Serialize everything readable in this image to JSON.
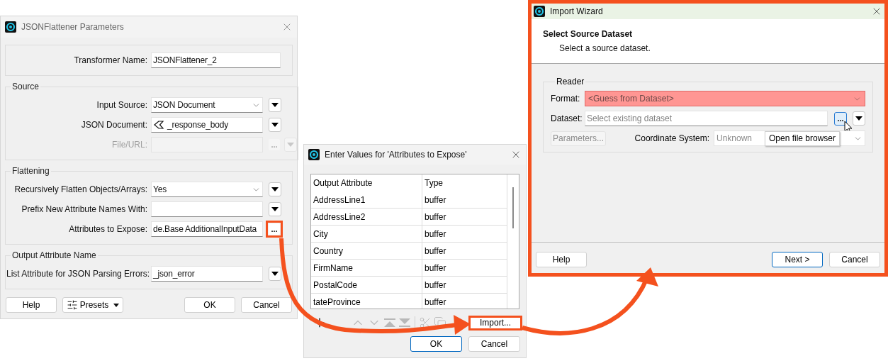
{
  "parameters_dialog": {
    "title": "JSONFlattener Parameters",
    "groups": [
      {
        "rows": [
          {
            "label": "Transformer Name:",
            "kind": "text",
            "value": "JSONFlattener_2",
            "disabled": false,
            "menu": false
          }
        ]
      },
      {
        "title": "Source",
        "rows": [
          {
            "label": "Input Source:",
            "kind": "select",
            "value": "JSON Document",
            "disabled": false,
            "menu": true
          },
          {
            "label": "JSON Document:",
            "kind": "attribute",
            "value": "_response_body",
            "disabled": false,
            "menu": true
          },
          {
            "label": "File/URL:",
            "kind": "text",
            "disabled": true,
            "browse": "...",
            "menu": true
          }
        ]
      },
      {
        "title": "Flattening",
        "rows": [
          {
            "label": "Recursively Flatten Objects/Arrays:",
            "kind": "select",
            "value": "Yes",
            "disabled": false,
            "menu": true
          },
          {
            "label": "Prefix New Attribute Names With:",
            "kind": "text",
            "disabled": false,
            "menu": true
          },
          {
            "label": "Attributes to Expose:",
            "kind": "text",
            "value": "de.Base AdditionalInputData",
            "disabled": false,
            "browse": "...",
            "callout": true,
            "menu": false
          }
        ]
      },
      {
        "title": "Output Attribute Name",
        "rows": [
          {
            "label": "List Attribute for JSON Parsing Errors:",
            "kind": "text",
            "value": "_json_error",
            "disabled": false,
            "menu": true
          }
        ]
      }
    ],
    "buttons": [
      {
        "kind": "help",
        "label": "Help"
      },
      {
        "kind": "presets",
        "label": "Presets"
      },
      {
        "kind": "ok",
        "label": "OK"
      },
      {
        "kind": "cancel",
        "label": "Cancel"
      }
    ]
  },
  "values_dialog": {
    "title": "Enter Values for 'Attributes to Expose'",
    "columns": [
      "Output Attribute",
      "Type"
    ],
    "rows": [
      [
        "AddressLine1",
        "buffer"
      ],
      [
        "AddressLine2",
        "buffer"
      ],
      [
        "City",
        "buffer"
      ],
      [
        "Country",
        "buffer"
      ],
      [
        "FirmName",
        "buffer"
      ],
      [
        "PostalCode",
        "buffer"
      ],
      [
        "tateProvince",
        "buffer"
      ]
    ],
    "toolbar": [
      {
        "kind": "add",
        "disabled": false
      },
      {
        "kind": "up",
        "disabled": true
      },
      {
        "kind": "down",
        "disabled": true
      },
      {
        "kind": "top",
        "disabled": true
      },
      {
        "kind": "bottom",
        "disabled": true
      },
      {
        "kind": "cut",
        "disabled": true
      },
      {
        "kind": "copy",
        "disabled": true
      }
    ],
    "import_button": {
      "label": "Import...",
      "callout": true
    },
    "buttons": [
      {
        "label": "OK",
        "default": true
      },
      {
        "label": "Cancel",
        "default": false
      }
    ]
  },
  "import_wizard": {
    "title": "Import Wizard",
    "callout": true,
    "heading": "Select Source Dataset",
    "subtitle": "Select a source dataset.",
    "group": "Reader",
    "format": {
      "label": "Format:",
      "value": "<Guess from Dataset>",
      "highlighted": true
    },
    "dataset": {
      "label": "Dataset:",
      "placeholder": "Select existing dataset",
      "browse": "...",
      "browse_focused": true
    },
    "parameters_button": {
      "label": "Parameters...",
      "disabled": true
    },
    "coordinate_system": {
      "label": "Coordinate System:",
      "value": "Unknown",
      "disabled": true
    },
    "tooltip": "Open file browser",
    "buttons": [
      {
        "kind": "help",
        "label": "Help",
        "default": false
      },
      {
        "kind": "next",
        "label": "Next >",
        "default": true
      },
      {
        "kind": "cancel",
        "label": "Cancel",
        "default": false
      }
    ]
  }
}
